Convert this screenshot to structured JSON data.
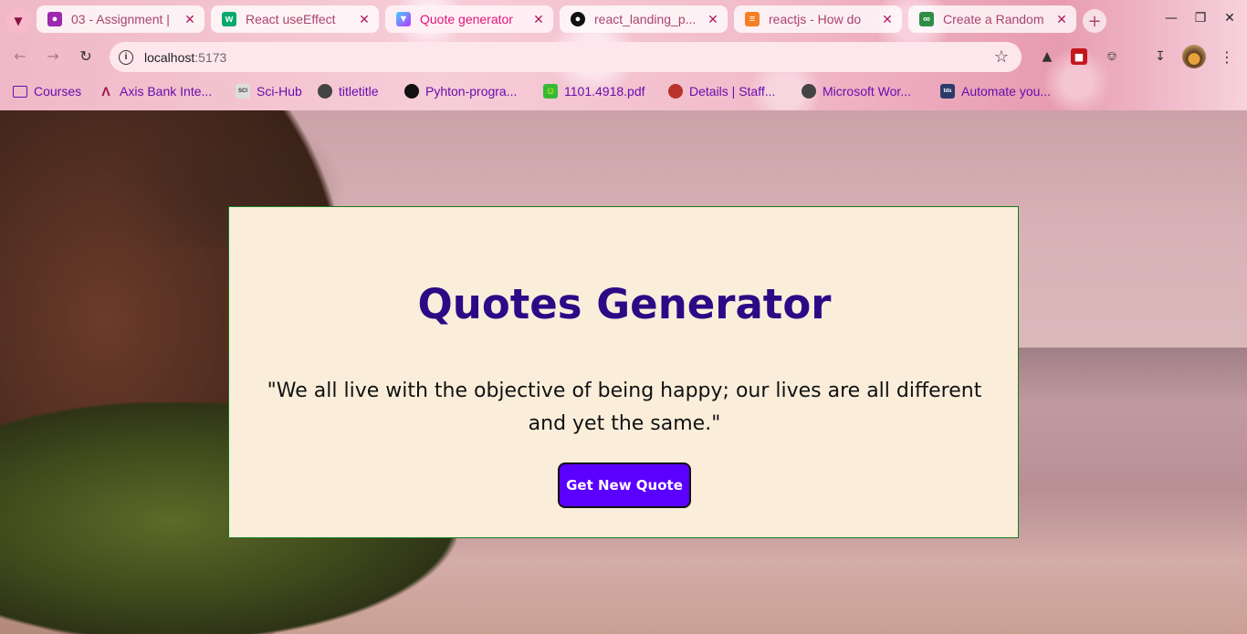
{
  "browser": {
    "tabs": [
      {
        "title": "03 - Assignment |",
        "favicon": "classroom-icon",
        "active": false
      },
      {
        "title": "React useEffect",
        "favicon": "w3schools-icon",
        "active": false
      },
      {
        "title": "Quote generator",
        "favicon": "vite-icon",
        "active": true
      },
      {
        "title": "react_landing_p...",
        "favicon": "github-icon",
        "active": false
      },
      {
        "title": "reactjs - How do",
        "favicon": "stackoverflow-icon",
        "active": false
      },
      {
        "title": "Create a Random",
        "favicon": "geeksforgeeks-icon",
        "active": false
      }
    ],
    "address": {
      "host": "localhost",
      "port": ":5173"
    },
    "bookmarks": [
      {
        "label": "Courses",
        "icon": "folder-icon"
      },
      {
        "label": "Axis Bank Inte...",
        "icon": "axis-bank-icon"
      },
      {
        "label": "Sci-Hub",
        "icon": "scihub-icon"
      },
      {
        "label": "titletitle",
        "icon": "globe-icon"
      },
      {
        "label": "Pyhton-progra...",
        "icon": "github-icon"
      },
      {
        "label": "1101.4918.pdf",
        "icon": "smiley-icon"
      },
      {
        "label": "Details | Staff...",
        "icon": "staff-icon"
      },
      {
        "label": "Microsoft Wor...",
        "icon": "globe-icon"
      },
      {
        "label": "Automate you...",
        "icon": "tds-icon"
      }
    ],
    "colors": {
      "active_tab_text": "#e0157e",
      "bookmark_text": "#6a0dad"
    }
  },
  "page": {
    "title": "Quotes Generator",
    "quote": "\"We all live with the objective of being happy; our lives are all different and yet the same.\"",
    "button_label": "Get New Quote",
    "colors": {
      "title": "#2b0a86",
      "button_bg": "#5b00ff",
      "card_bg": "#faeedb",
      "card_border": "#1a7a1a"
    }
  }
}
